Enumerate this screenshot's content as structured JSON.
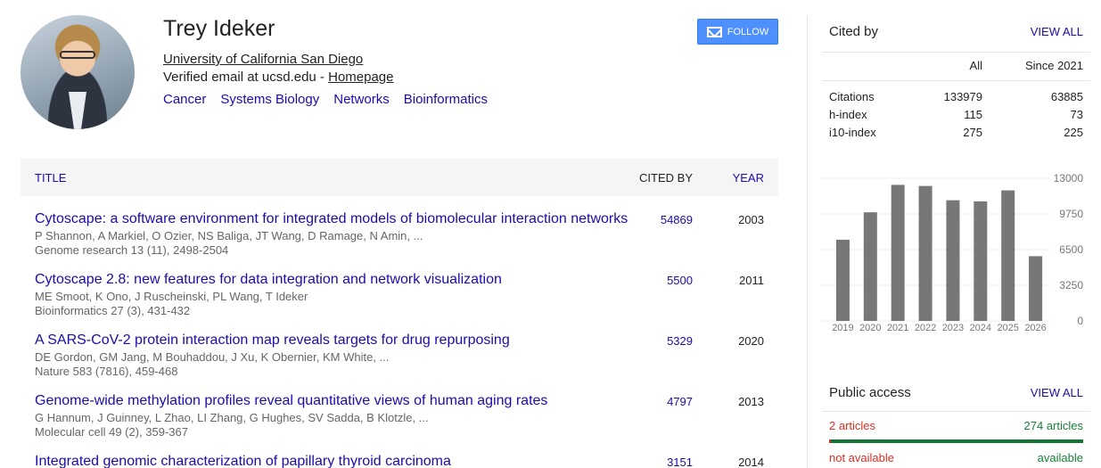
{
  "profile": {
    "name": "Trey Ideker",
    "affiliation": "University of California San Diego",
    "email_text": "Verified email at ucsd.edu - ",
    "homepage": "Homepage",
    "interests": [
      "Cancer",
      "Systems Biology",
      "Networks",
      "Bioinformatics"
    ],
    "follow_label": "FOLLOW"
  },
  "table": {
    "col_title": "TITLE",
    "col_cited": "CITED BY",
    "col_year": "YEAR",
    "rows": [
      {
        "title": "Cytoscape: a software environment for integrated models of biomolecular interaction networks",
        "authors": "P Shannon, A Markiel, O Ozier, NS Baliga, JT Wang, D Ramage, N Amin, ...",
        "venue": "Genome research 13 (11), 2498-2504",
        "cites": "54869",
        "year": "2003"
      },
      {
        "title": "Cytoscape 2.8: new features for data integration and network visualization",
        "authors": "ME Smoot, K Ono, J Ruscheinski, PL Wang, T Ideker",
        "venue": "Bioinformatics 27 (3), 431-432",
        "cites": "5500",
        "year": "2011"
      },
      {
        "title": "A SARS-CoV-2 protein interaction map reveals targets for drug repurposing",
        "authors": "DE Gordon, GM Jang, M Bouhaddou, J Xu, K Obernier, KM White, ...",
        "venue": "Nature 583 (7816), 459-468",
        "cites": "5329",
        "year": "2020"
      },
      {
        "title": "Genome-wide methylation profiles reveal quantitative views of human aging rates",
        "authors": "G Hannum, J Guinney, L Zhao, LI Zhang, G Hughes, SV Sadda, B Klotzle, ...",
        "venue": "Molecular cell 49 (2), 359-367",
        "cites": "4797",
        "year": "2013"
      },
      {
        "title": "Integrated genomic characterization of papillary thyroid carcinoma",
        "authors": "",
        "venue": "",
        "cites": "3151",
        "year": "2014"
      }
    ]
  },
  "cited_by": {
    "heading": "Cited by",
    "view_all": "VIEW ALL",
    "col_all": "All",
    "col_since": "Since 2021",
    "stats": [
      {
        "label": "Citations",
        "all": "133979",
        "since": "63885"
      },
      {
        "label": "h-index",
        "all": "115",
        "since": "73"
      },
      {
        "label": "i10-index",
        "all": "275",
        "since": "225"
      }
    ]
  },
  "chart_data": {
    "type": "bar",
    "categories": [
      "2019",
      "2020",
      "2021",
      "2022",
      "2023",
      "2024",
      "2025",
      "2026"
    ],
    "values": [
      7400,
      9900,
      12400,
      12300,
      11000,
      10900,
      11900,
      5900
    ],
    "ylim": [
      0,
      13000
    ],
    "yticks": [
      "13000",
      "9750",
      "6500",
      "3250",
      "0"
    ],
    "bar_color": "#777777",
    "grid": true
  },
  "public_access": {
    "heading": "Public access",
    "view_all": "VIEW ALL",
    "not_available_count": "2 articles",
    "available_count": "274 articles",
    "not_available_label": "not available",
    "available_label": "available"
  }
}
